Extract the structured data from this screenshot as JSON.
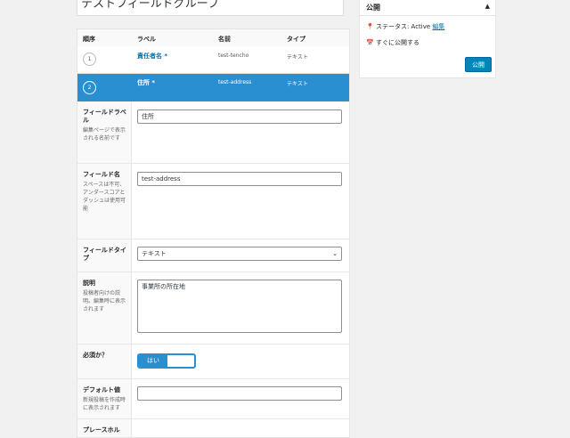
{
  "title_input": {
    "value": "テストフィールドグループ"
  },
  "fields_table": {
    "headers": {
      "order": "順序",
      "label": "ラベル",
      "name": "名前",
      "type": "タイプ"
    },
    "rows": [
      {
        "order": "1",
        "label": "責任者名 *",
        "name": "test-tencho",
        "type": "テキスト"
      },
      {
        "order": "2",
        "label": "住所 *",
        "name": "test-address",
        "type": "テキスト"
      }
    ]
  },
  "settings": {
    "field_label": {
      "title": "フィールドラベル",
      "desc": "編集ページで表示される名前です",
      "value": "住所"
    },
    "field_name": {
      "title": "フィールド名",
      "desc": "スペースは不可、アンダースコアとダッシュは使用可能",
      "value": "test-address"
    },
    "field_type": {
      "title": "フィールドタイプ",
      "value": "テキスト"
    },
    "description": {
      "title": "説明",
      "desc": "投稿者向けの説明。編集時に表示されます",
      "value": "事業所の所在地"
    },
    "required": {
      "title": "必須か？",
      "toggle_label": "はい"
    },
    "default_value": {
      "title": "デフォルト値",
      "desc": "新規投稿を作成時に表示されます",
      "value": ""
    },
    "placeholder": {
      "title": "プレースホル"
    }
  },
  "publish_box": {
    "title": "公開",
    "status_label": "ステータス: Active",
    "status_edit": "編集",
    "schedule": "すぐに公開する",
    "publish_button": "公開"
  },
  "colors": {
    "accent": "#2a8fd0",
    "button": "#0085ba",
    "link": "#0073aa"
  }
}
